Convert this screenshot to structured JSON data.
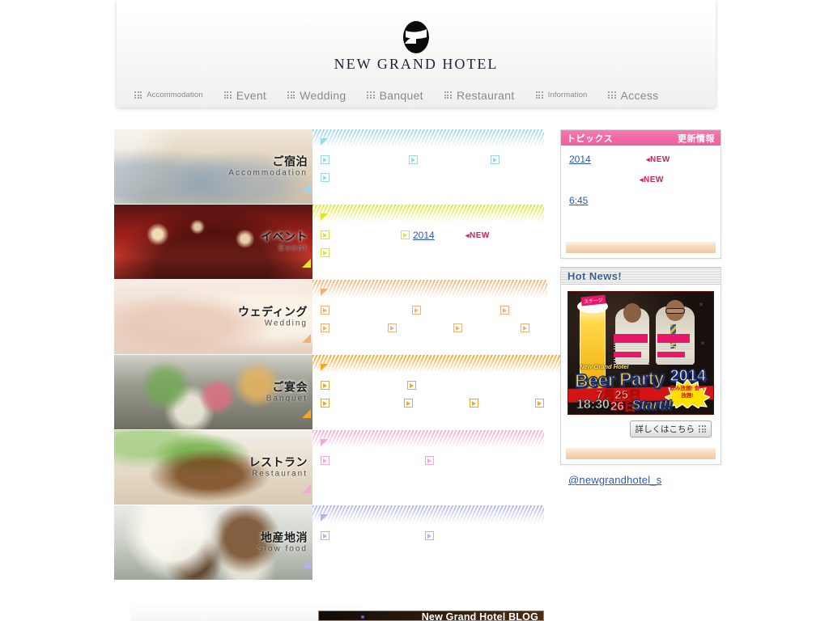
{
  "site": {
    "brand_name": "NEW GRAND HOTEL",
    "logo_icon": "ngh-monogram-logo"
  },
  "nav": {
    "items": [
      {
        "label": "Accommodation",
        "icon": "grid-dots-icon",
        "size": "small"
      },
      {
        "label": "Event",
        "icon": "grid-dots-icon",
        "size": "normal"
      },
      {
        "label": "Wedding",
        "icon": "grid-dots-icon",
        "size": "normal"
      },
      {
        "label": "Banquet",
        "icon": "grid-dots-icon",
        "size": "normal"
      },
      {
        "label": "Restaurant",
        "icon": "grid-dots-icon",
        "size": "normal"
      },
      {
        "label": "Information",
        "icon": "grid-dots-icon",
        "size": "small"
      },
      {
        "label": "Access",
        "icon": "grid-dots-icon",
        "size": "normal"
      }
    ]
  },
  "categories": [
    {
      "id": "accommodation",
      "title_ja": "ご宿泊",
      "title_en": "Accommodation",
      "accent": "#9cd6ea",
      "thumb": "guest-room-photo",
      "rows": [
        {
          "links": [
            {
              "text": "",
              "bullet": "triangle",
              "width": 26
            }
          ]
        },
        {
          "links": [
            {
              "text": "",
              "bullet": "square",
              "width": 22,
              "gap": 72
            },
            {
              "text": "",
              "bullet": "square",
              "width": 26,
              "gap": 60
            },
            {
              "text": "",
              "bullet": "square",
              "width": 26,
              "gap": 0
            }
          ]
        },
        {
          "links": [
            {
              "text": "",
              "bullet": "square",
              "width": 38
            }
          ]
        }
      ]
    },
    {
      "id": "event",
      "title_ja": "イベント",
      "title_en": "Event",
      "accent": "#dde62a",
      "thumb": "banquet-table-photo",
      "rows": [
        {
          "links": [
            {
              "text": "",
              "bullet": "triangle",
              "width": 26
            }
          ]
        },
        {
          "links": [
            {
              "text": "",
              "bullet": "square",
              "width": 14,
              "gap": 70
            },
            {
              "text": "   2014",
              "bullet": "square",
              "width": 60,
              "gap": 0,
              "badge": "NEW"
            }
          ]
        },
        {
          "links": [
            {
              "text": "",
              "bullet": "square",
              "width": 42
            }
          ]
        }
      ]
    },
    {
      "id": "wedding",
      "title_ja": "ウェディング",
      "title_en": "Wedding",
      "accent": "#f0b177",
      "thumb": "wedding-hands-photo",
      "rows": [
        {
          "links": [
            {
              "text": "",
              "bullet": "triangle",
              "width": 30
            }
          ]
        },
        {
          "links": [
            {
              "text": "",
              "bullet": "square",
              "width": 28,
              "gap": 70
            },
            {
              "text": "",
              "bullet": "square",
              "width": 26,
              "gap": 68
            },
            {
              "text": "",
              "bullet": "square",
              "width": 16,
              "gap": 0
            }
          ]
        },
        {
          "links": [
            {
              "text": "",
              "bullet": "square",
              "width": 14,
              "gap": 54
            },
            {
              "text": "",
              "bullet": "square",
              "width": 14,
              "gap": 52
            },
            {
              "text": "",
              "bullet": "square",
              "width": 14,
              "gap": 54
            },
            {
              "text": "",
              "bullet": "square",
              "width": 14,
              "gap": 0
            }
          ]
        }
      ]
    },
    {
      "id": "banquet",
      "title_ja": "ご宴会",
      "title_en": "Banquet",
      "accent": "#f5a623",
      "thumb": "kaiseki-meal-photo",
      "rows": [
        {
          "links": [
            {
              "text": "",
              "bullet": "triangle",
              "width": 20
            }
          ]
        },
        {
          "links": [
            {
              "text": "",
              "bullet": "square",
              "width": 18,
              "gap": 74
            },
            {
              "text": "",
              "bullet": "square",
              "width": 28,
              "gap": 0
            }
          ]
        },
        {
          "links": [
            {
              "text": "",
              "bullet": "square",
              "width": 30,
              "gap": 58
            },
            {
              "text": "",
              "bullet": "square",
              "width": 16,
              "gap": 50
            },
            {
              "text": "",
              "bullet": "square",
              "width": 18,
              "gap": 48
            },
            {
              "text": "",
              "bullet": "square",
              "width": 14,
              "gap": 0
            }
          ]
        }
      ]
    },
    {
      "id": "restaurant",
      "title_ja": "レストラン",
      "title_en": "Restaurant",
      "accent": "#f2a9d6",
      "thumb": "pork-dish-photo",
      "rows": [
        {
          "links": [
            {
              "text": "",
              "bullet": "triangle",
              "width": 26
            }
          ]
        },
        {
          "links": [
            {
              "text": "",
              "bullet": "square",
              "width": 16,
              "gap": 98
            },
            {
              "text": "",
              "bullet": "square",
              "width": 20,
              "gap": 0
            }
          ]
        }
      ]
    },
    {
      "id": "slowfood",
      "title_ja": "地産地消",
      "title_en": "Slow food",
      "accent": "#b2b4e8",
      "thumb": "mushrooms-photo",
      "rows": [
        {
          "links": [
            {
              "text": "",
              "bullet": "triangle",
              "width": 24
            }
          ]
        },
        {
          "links": [
            {
              "text": "",
              "bullet": "square",
              "width": 36,
              "gap": 78
            },
            {
              "text": "",
              "bullet": "square",
              "width": 14,
              "gap": 0
            }
          ]
        }
      ]
    }
  ],
  "topics": {
    "header_left": "トピックス",
    "header_right": "更新情報",
    "items": [
      {
        "text": "    2014    ",
        "badge": "NEW"
      },
      {
        "text": "          ",
        "badge": "NEW"
      },
      {
        "text": "  6:45          ",
        "badge": ""
      },
      {
        "text": "      ",
        "badge": ""
      }
    ]
  },
  "hot_news": {
    "header": "Hot News!",
    "poster": {
      "alt": "beer-party-2014-poster",
      "brand": "New Grand Hotel",
      "title": "Beer Party",
      "year": "2014",
      "date_line1": "7月25日",
      "date_line2": "26日",
      "time": "18:30",
      "start": "Start!!",
      "stage_tag": "ステージ",
      "burst": "飲み放題! 食べ放題!"
    },
    "detail_button": "詳しくはこちら",
    "detail_button_icon": "grid-dots-icon"
  },
  "twitter": {
    "handle": "@newgrandhotel_s"
  },
  "bottom": {
    "blog_title": "New Grand Hotel BLOG"
  },
  "colors": {
    "accent_pink": "#ee5f9e",
    "link_blue": "#2a56c6",
    "new_red": "#d81e5b",
    "hot_news_blue": "#2f5f9e",
    "nav_gray": "#8a8a8a"
  }
}
